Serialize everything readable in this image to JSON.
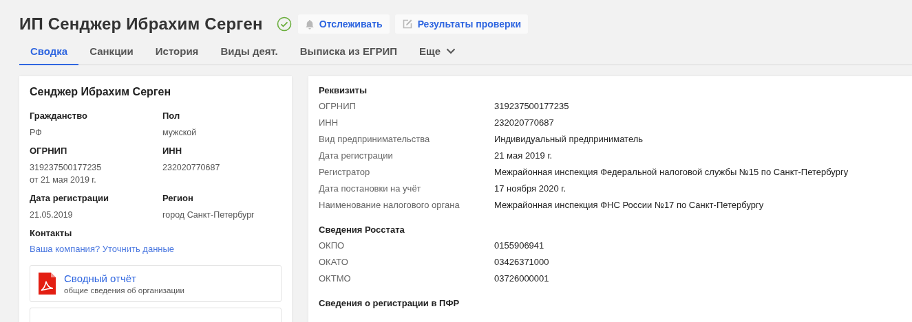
{
  "header": {
    "title": "ИП Сенджер Ибрахим Серген",
    "verified": true,
    "buttons": [
      {
        "kind": "bell",
        "label": "Отслеживать"
      },
      {
        "kind": "edit",
        "label": "Результаты проверки"
      }
    ]
  },
  "tabs": [
    {
      "label": "Сводка",
      "selected": true
    },
    {
      "label": "Санкции",
      "selected": false
    },
    {
      "label": "История",
      "selected": false
    },
    {
      "label": "Виды деят.",
      "selected": false
    },
    {
      "label": "Выписка из ЕГРИП",
      "selected": false
    },
    {
      "label": "Еще",
      "selected": false,
      "dropdown": true
    }
  ],
  "summary_card": {
    "name": "Сенджер Ибрахим Серген",
    "fields": [
      {
        "label": "Гражданство",
        "values": [
          "РФ"
        ]
      },
      {
        "label": "Пол",
        "values": [
          "мужской"
        ]
      },
      {
        "label": "ОГРНИП",
        "values": [
          "319237500177235",
          "от 21 мая 2019 г."
        ]
      },
      {
        "label": "ИНН",
        "values": [
          "232020770687"
        ]
      },
      {
        "label": "Дата регистрации",
        "values": [
          "21.05.2019"
        ]
      },
      {
        "label": "Регион",
        "values": [
          "город Санкт-Петербург"
        ]
      }
    ],
    "contacts": {
      "label": "Контакты",
      "link": "Ваша компания? Уточнить данные"
    },
    "reports": [
      {
        "title": "Сводный отчёт",
        "subtitle": "общие сведения об организации"
      }
    ]
  },
  "details": [
    {
      "title": "Реквизиты",
      "rows": [
        {
          "label": "ОГРНИП",
          "value": "319237500177235"
        },
        {
          "label": "ИНН",
          "value": "232020770687"
        },
        {
          "label": "Вид предпринимательства",
          "value": "Индивидуальный предприниматель"
        },
        {
          "label": "Дата регистрации",
          "value": "21 мая 2019 г."
        },
        {
          "label": "Регистратор",
          "value": "Межрайонная инспекция Федеральной налоговой службы №15 по Санкт-Петербургу"
        },
        {
          "label": "Дата постановки на учёт",
          "value": "17 ноября 2020 г."
        },
        {
          "label": "Наименование налогового органа",
          "value": "Межрайонная инспекция ФНС России №17 по Санкт-Петербургу"
        }
      ]
    },
    {
      "title": "Сведения Росстата",
      "rows": [
        {
          "label": "ОКПО",
          "value": "0155906941"
        },
        {
          "label": "ОКАТО",
          "value": "03426371000"
        },
        {
          "label": "ОКТМО",
          "value": "03726000001"
        }
      ]
    },
    {
      "title": "Сведения о регистрации в ПФР"
    }
  ]
}
